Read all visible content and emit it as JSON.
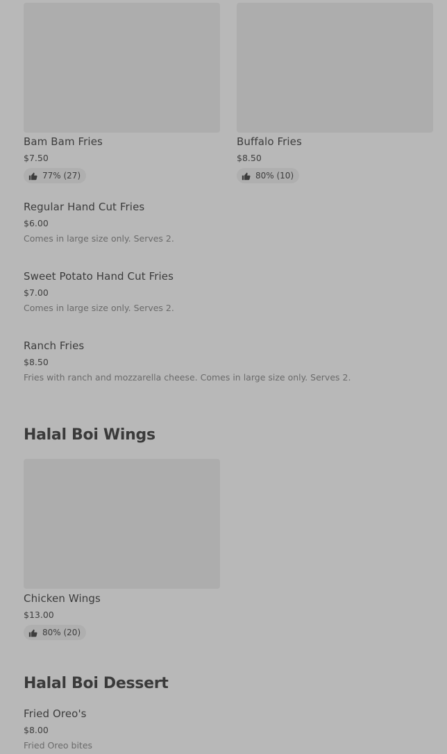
{
  "fries_cards": [
    {
      "name": "Bam Bam Fries",
      "price": "$7.50",
      "rating": "77% (27)"
    },
    {
      "name": "Buffalo Fries",
      "price": "$8.50",
      "rating": "80% (10)"
    }
  ],
  "fries_list": [
    {
      "name": "Regular Hand Cut Fries",
      "price": "$6.00",
      "desc": "Comes in large size only. Serves 2."
    },
    {
      "name": "Sweet Potato Hand Cut Fries",
      "price": "$7.00",
      "desc": "Comes in large size only. Serves 2."
    },
    {
      "name": "Ranch Fries",
      "price": "$8.50",
      "desc": "Fries with ranch and mozzarella cheese. Comes in large size only. Serves 2."
    }
  ],
  "wings_section": {
    "title": "Halal Boi Wings",
    "card": {
      "name": "Chicken Wings",
      "price": "$13.00",
      "rating": "80% (20)"
    }
  },
  "dessert_section": {
    "title": "Halal Boi Dessert",
    "item": {
      "name": "Fried Oreo's",
      "price": "$8.00",
      "desc": "Fried Oreo bites"
    }
  },
  "icons": {
    "rating": "thumbs-up-icon"
  }
}
